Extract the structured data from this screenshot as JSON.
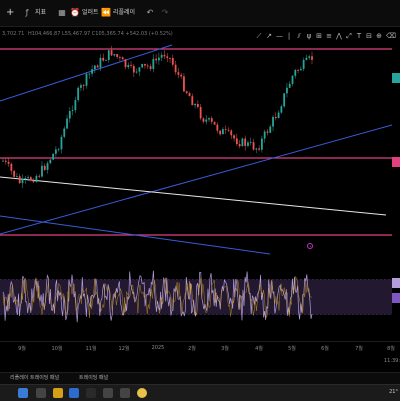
{
  "toolbar": {
    "plus_label": "+",
    "indicators_label": "지표",
    "alert_label": "얼러트",
    "replay_label": "리플레이",
    "undo_icon": "undo-icon",
    "redo_icon": "redo-icon"
  },
  "sub_header": {
    "left_text": "3,702.71",
    "middle_text": "H104,466.87  L55,467.97  C105,365.74  +542.03 (+0.52%)"
  },
  "drawing_tools": [
    "trend-line-icon",
    "ray-icon",
    "horizontal-line-icon",
    "vertical-line-icon",
    "parallel-channel-icon",
    "pitchfork-icon",
    "gann-icon",
    "fib-icon",
    "pattern-icon",
    "projection-icon",
    "text-icon",
    "ruler-icon",
    "zoom-icon",
    "trash-icon"
  ],
  "time_axis": {
    "ticks": [
      {
        "label": "9월"
      },
      {
        "label": "10월"
      },
      {
        "label": "11월"
      },
      {
        "label": "12월"
      },
      {
        "label": "2025"
      },
      {
        "label": "2월"
      },
      {
        "label": "3월"
      },
      {
        "label": "4월"
      },
      {
        "label": "5월"
      },
      {
        "label": "6월"
      },
      {
        "label": "7월"
      },
      {
        "label": "8월"
      }
    ],
    "clock": "11:39:"
  },
  "bottom_panel": {
    "item_1": "리플레이 트레이딩 패널",
    "item_2": "트레이딩 패널"
  },
  "taskbar": {
    "clock": "21°"
  },
  "colors": {
    "background": "#000000",
    "magenta_level": "#e0427f",
    "blue_trend": "#3a5bd9",
    "white_trend": "#e8e8e8",
    "candle_up": "#26a69a",
    "candle_down": "#ef5350",
    "oscillator_line": "#b39ddb",
    "oscillator_band": "#2a1f3d"
  },
  "chart_data": {
    "type": "candlestick",
    "x_categories": [
      "9월",
      "10월",
      "11월",
      "12월",
      "2025",
      "2월",
      "3월",
      "4월",
      "5월",
      "6월",
      "7월",
      "8월"
    ],
    "trend": [
      [
        "8월",
        0.56
      ],
      [
        "9월",
        0.67
      ],
      [
        "10월",
        0.62
      ],
      [
        "11월",
        0.5
      ],
      [
        "11월",
        0.26
      ],
      [
        "12월",
        0.12
      ],
      [
        "12월",
        0.05
      ],
      [
        "2025",
        0.14
      ],
      [
        "2025",
        0.12
      ],
      [
        "2월",
        0.05
      ],
      [
        "2월",
        0.22
      ],
      [
        "3월",
        0.36
      ],
      [
        "3월",
        0.42
      ],
      [
        "4월",
        0.47
      ],
      [
        "4월",
        0.5
      ],
      [
        "5월",
        0.35
      ],
      [
        "5월",
        0.15
      ],
      [
        "5월",
        0.08
      ]
    ],
    "oscillator": {
      "band": [
        0.25,
        0.75
      ]
    }
  }
}
